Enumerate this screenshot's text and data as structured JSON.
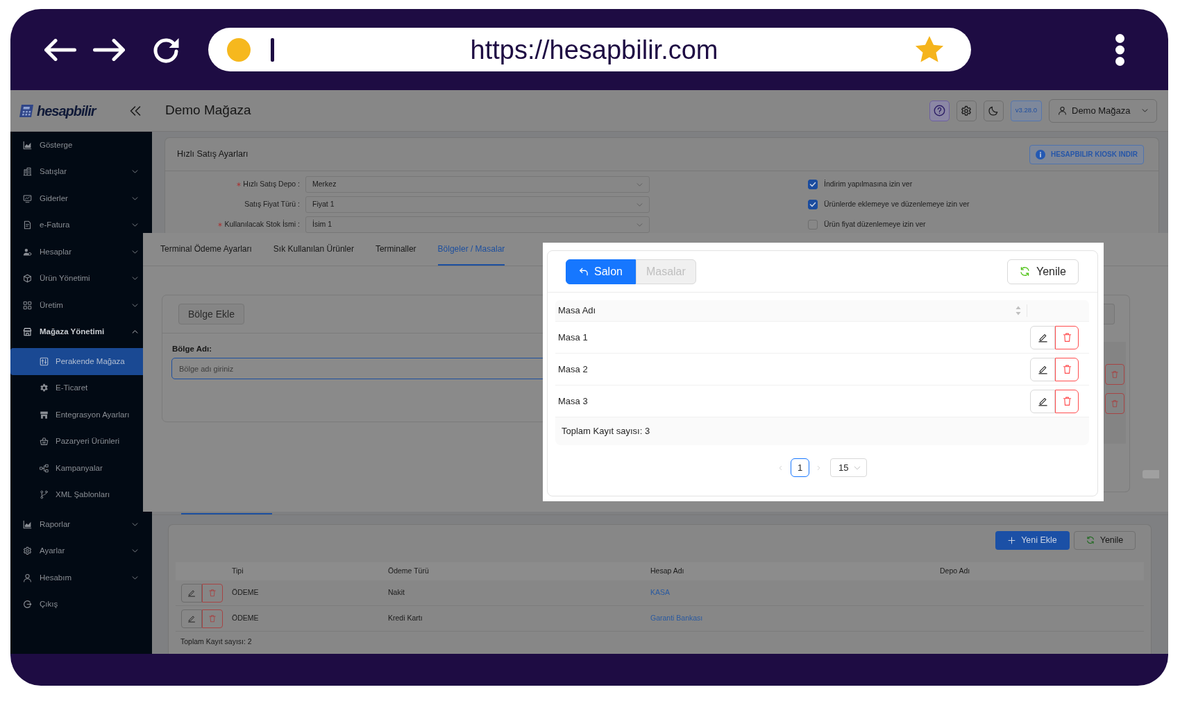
{
  "browser": {
    "url": "https://hesapbilir.com"
  },
  "header": {
    "brand": "hesapbilir",
    "title": "Demo Mağaza",
    "version": "v3.28.0",
    "user": "Demo Mağaza"
  },
  "sidebar": {
    "items": [
      {
        "label": "Gösterge",
        "kind": "link",
        "selected": false
      },
      {
        "label": "Satışlar",
        "kind": "group",
        "expanded": false,
        "selected": false
      },
      {
        "label": "Giderler",
        "kind": "group",
        "expanded": false,
        "selected": false
      },
      {
        "label": "e-Fatura",
        "kind": "group",
        "expanded": false,
        "selected": false
      },
      {
        "label": "Hesaplar",
        "kind": "group",
        "expanded": false,
        "selected": false
      },
      {
        "label": "Ürün Yönetimi",
        "kind": "group",
        "expanded": false,
        "selected": false
      },
      {
        "label": "Üretim",
        "kind": "group",
        "expanded": false,
        "selected": false
      },
      {
        "label": "Mağaza Yönetimi",
        "kind": "group",
        "expanded": true,
        "selected": false,
        "children": [
          {
            "label": "Perakende Mağaza",
            "selected": true
          },
          {
            "label": "E-Ticaret",
            "selected": false
          },
          {
            "label": "Entegrasyon Ayarları",
            "selected": false
          },
          {
            "label": "Pazaryeri Ürünleri",
            "selected": false
          },
          {
            "label": "Kampanyalar",
            "selected": false
          },
          {
            "label": "XML Şablonları",
            "selected": false
          }
        ]
      },
      {
        "label": "Raporlar",
        "kind": "group",
        "expanded": false,
        "selected": false
      },
      {
        "label": "Ayarlar",
        "kind": "group",
        "expanded": false,
        "selected": false
      },
      {
        "label": "Hesabım",
        "kind": "group",
        "expanded": false,
        "selected": false
      },
      {
        "label": "Çıkış",
        "kind": "link",
        "selected": false
      }
    ]
  },
  "quick_sale_settings": {
    "title": "Hızlı Satış Ayarları",
    "kiosk_button": "HESAPBILIR KIOSK INDIR",
    "fields": [
      {
        "label": "Hızlı Satış Depo :",
        "required": true,
        "value": "Merkez"
      },
      {
        "label": "Satış Fiyat Türü :",
        "required": false,
        "value": "Fiyat 1"
      },
      {
        "label": "Kullanılacak Stok İsmi :",
        "required": true,
        "value": "İsim 1"
      }
    ],
    "options": [
      {
        "label": "İndirim yapılmasına izin ver",
        "checked": true
      },
      {
        "label": "Ürünlerde eklemeye ve düzenlemeye izin ver",
        "checked": true
      },
      {
        "label": "Ürün fiyat düzenlemeye izin ver",
        "checked": false
      }
    ]
  },
  "terminal_tabs": [
    {
      "label": "Terminal Ödeme Ayarları",
      "selected": false
    },
    {
      "label": "Sık Kullanılan Ürünler",
      "selected": false
    },
    {
      "label": "Terminaller",
      "selected": false
    },
    {
      "label": "Bölgeler / Masalar",
      "selected": true
    }
  ],
  "region_form": {
    "add_button": "Bölge Ekle",
    "label": "Bölge Adı:",
    "placeholder": "Bölge adı giriniz"
  },
  "tables_modal": {
    "segments": [
      {
        "label": "Salon",
        "selected": true
      },
      {
        "label": "Masalar",
        "selected": false
      }
    ],
    "refresh_button": "Yenile",
    "columns": [
      "Masa Adı"
    ],
    "rows": [
      {
        "name": "Masa 1"
      },
      {
        "name": "Masa 2"
      },
      {
        "name": "Masa 3"
      }
    ],
    "total": "Toplam Kayıt sayısı: 3",
    "pagination": {
      "pages": [
        {
          "label": "1",
          "selected": true
        }
      ],
      "page_size": "15"
    }
  },
  "payment_settings": {
    "add_button": "Yeni Ekle",
    "refresh_button": "Yenile",
    "columns": [
      "Tipi",
      "Ödeme Türü",
      "Hesap Adı",
      "Depo Adı"
    ],
    "rows": [
      {
        "type": "ÖDEME",
        "payment_type": "Nakit",
        "account": "KASA"
      },
      {
        "type": "ÖDEME",
        "payment_type": "Kredi Kartı",
        "account": "Garanti Bankası"
      }
    ],
    "total": "Toplam Kayıt sayısı: 2"
  }
}
